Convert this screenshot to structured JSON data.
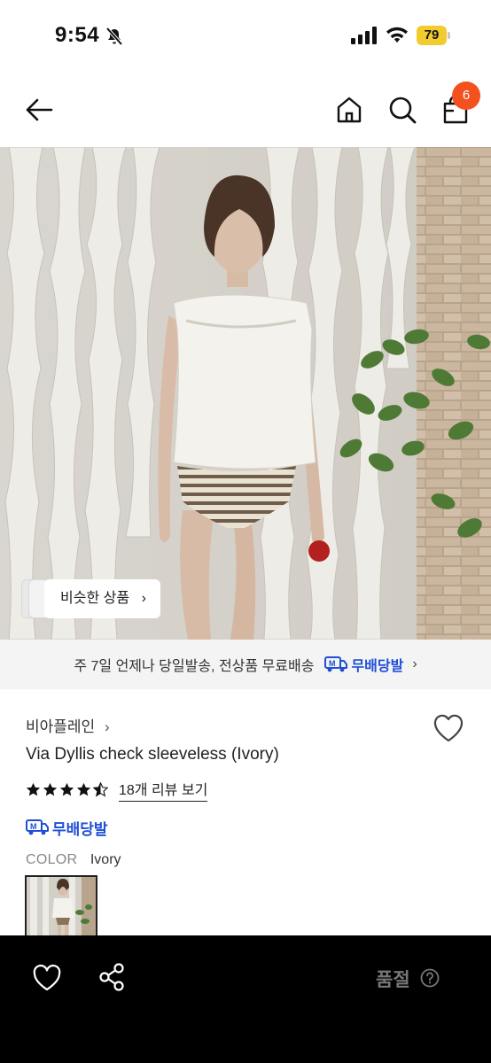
{
  "status_bar": {
    "time": "9:54",
    "battery": "79"
  },
  "nav": {
    "cart_count": "6"
  },
  "hero": {
    "similar_button": "비슷한 상품"
  },
  "shipping_banner": {
    "text": "주 7일 언제나 당일발송, 전상품 무료배송",
    "free_label": "무배당발"
  },
  "product": {
    "brand": "비아플레인",
    "name": "Via Dyllis check sleeveless (Ivory)",
    "rating": 4.5,
    "review_link": "18개 리뷰 보기",
    "free_shipping": "무배당발",
    "color_key": "COLOR",
    "color_value": "Ivory"
  },
  "bottom_bar": {
    "soldout_label": "품절"
  },
  "icons": [
    "mute-icon",
    "signal-icon",
    "wifi-icon",
    "back-icon",
    "home-icon",
    "search-icon",
    "cart-icon",
    "chevron-right-icon",
    "heart-icon",
    "star-icon",
    "share-icon",
    "help-icon"
  ],
  "colors": {
    "accent": "#f4511e",
    "brand_blue": "#1f4fd6",
    "battery": "#f2cc2f"
  }
}
